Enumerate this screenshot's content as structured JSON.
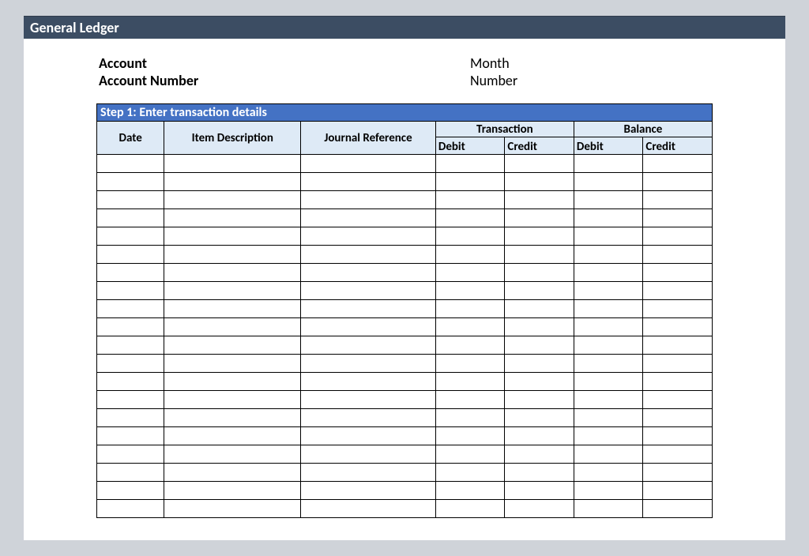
{
  "header": {
    "title": "General Ledger"
  },
  "info": {
    "account_label": "Account",
    "account_number_label": "Account Number",
    "month_label": "Month",
    "number_label": "Number"
  },
  "section": {
    "step_title": "Step 1: Enter transaction details"
  },
  "columns": {
    "date": "Date",
    "item_description": "Item Description",
    "journal_reference": "Journal Reference",
    "transaction_group": "Transaction",
    "balance_group": "Balance",
    "debit": "Debit",
    "credit": "Credit"
  },
  "rows": [
    {
      "date": "",
      "item": "",
      "jref": "",
      "txd": "",
      "txc": "",
      "bad": "",
      "bac": ""
    },
    {
      "date": "",
      "item": "",
      "jref": "",
      "txd": "",
      "txc": "",
      "bad": "",
      "bac": ""
    },
    {
      "date": "",
      "item": "",
      "jref": "",
      "txd": "",
      "txc": "",
      "bad": "",
      "bac": ""
    },
    {
      "date": "",
      "item": "",
      "jref": "",
      "txd": "",
      "txc": "",
      "bad": "",
      "bac": ""
    },
    {
      "date": "",
      "item": "",
      "jref": "",
      "txd": "",
      "txc": "",
      "bad": "",
      "bac": ""
    },
    {
      "date": "",
      "item": "",
      "jref": "",
      "txd": "",
      "txc": "",
      "bad": "",
      "bac": ""
    },
    {
      "date": "",
      "item": "",
      "jref": "",
      "txd": "",
      "txc": "",
      "bad": "",
      "bac": ""
    },
    {
      "date": "",
      "item": "",
      "jref": "",
      "txd": "",
      "txc": "",
      "bad": "",
      "bac": ""
    },
    {
      "date": "",
      "item": "",
      "jref": "",
      "txd": "",
      "txc": "",
      "bad": "",
      "bac": ""
    },
    {
      "date": "",
      "item": "",
      "jref": "",
      "txd": "",
      "txc": "",
      "bad": "",
      "bac": ""
    },
    {
      "date": "",
      "item": "",
      "jref": "",
      "txd": "",
      "txc": "",
      "bad": "",
      "bac": ""
    },
    {
      "date": "",
      "item": "",
      "jref": "",
      "txd": "",
      "txc": "",
      "bad": "",
      "bac": ""
    },
    {
      "date": "",
      "item": "",
      "jref": "",
      "txd": "",
      "txc": "",
      "bad": "",
      "bac": ""
    },
    {
      "date": "",
      "item": "",
      "jref": "",
      "txd": "",
      "txc": "",
      "bad": "",
      "bac": ""
    },
    {
      "date": "",
      "item": "",
      "jref": "",
      "txd": "",
      "txc": "",
      "bad": "",
      "bac": ""
    },
    {
      "date": "",
      "item": "",
      "jref": "",
      "txd": "",
      "txc": "",
      "bad": "",
      "bac": ""
    },
    {
      "date": "",
      "item": "",
      "jref": "",
      "txd": "",
      "txc": "",
      "bad": "",
      "bac": ""
    },
    {
      "date": "",
      "item": "",
      "jref": "",
      "txd": "",
      "txc": "",
      "bad": "",
      "bac": ""
    },
    {
      "date": "",
      "item": "",
      "jref": "",
      "txd": "",
      "txc": "",
      "bad": "",
      "bac": ""
    },
    {
      "date": "",
      "item": "",
      "jref": "",
      "txd": "",
      "txc": "",
      "bad": "",
      "bac": ""
    }
  ]
}
